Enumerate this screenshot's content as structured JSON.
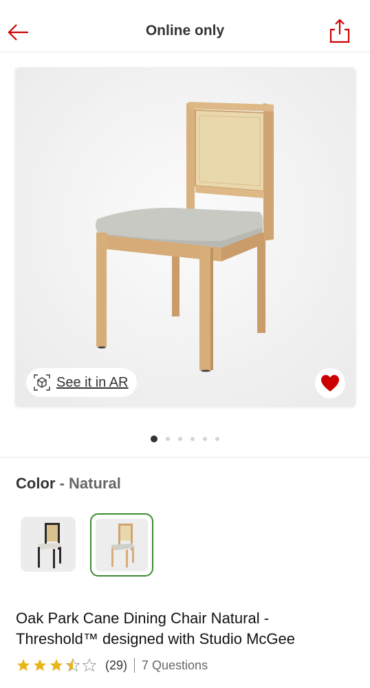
{
  "header": {
    "title": "Online only",
    "back_icon": "back-arrow-icon",
    "share_icon": "share-icon",
    "accent_color": "#cc0000"
  },
  "gallery": {
    "ar_label": "See it in AR",
    "ar_icon": "ar-cube-icon",
    "favorite_icon": "heart-icon",
    "image_count": 6,
    "active_index": 0
  },
  "color": {
    "label": "Color",
    "separator": "-",
    "selected": "Natural"
  },
  "product": {
    "title": "Oak Park Cane Dining Chair Natural - Threshold™ designed with Studio McGee",
    "rating": 3.5,
    "rating_max": 5,
    "review_count": "(29)",
    "questions": "7 Questions"
  }
}
